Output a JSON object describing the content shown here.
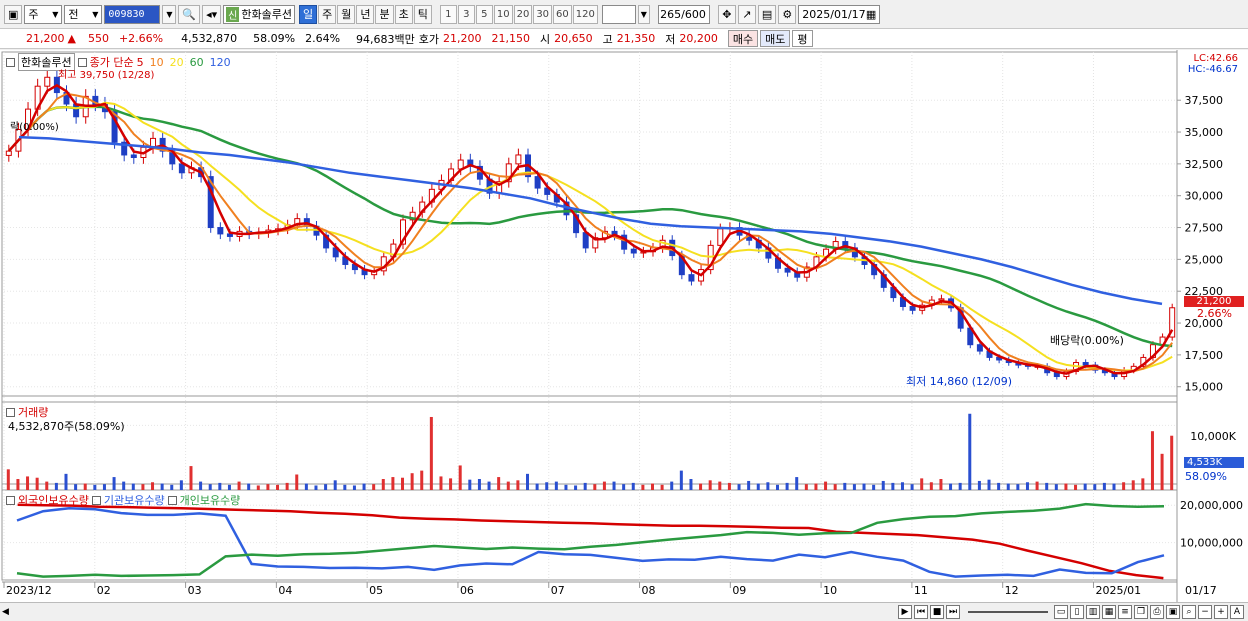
{
  "toolbar": {
    "period_type": "주",
    "prev_label": "전",
    "stock_code": "009830",
    "shin_badge": "신",
    "stock_name": "한화솔루션",
    "period_tabs": [
      "일",
      "주",
      "월",
      "년",
      "분",
      "초",
      "틱"
    ],
    "active_period": "일",
    "interval_buttons": [
      "1",
      "3",
      "5",
      "10",
      "20",
      "30",
      "60",
      "120"
    ],
    "count_current": "265",
    "count_max": "/600",
    "date": "2025/01/17"
  },
  "quote": {
    "price": "21,200",
    "change_arrow": "▲",
    "change": "550",
    "change_pct": "+2.66%",
    "volume": "4,532,870",
    "volume_ratio": "58.09%",
    "turnover": "2.64%",
    "amount": "94,683백만",
    "ask_label": "호가",
    "ask": "21,200",
    "bid": "21,150",
    "open_label": "시",
    "open": "20,650",
    "high_label": "고",
    "high": "21,350",
    "low_label": "저",
    "low": "20,200",
    "buy_label": "매수",
    "sell_label": "매도",
    "eval_label": "평"
  },
  "chart_data": {
    "type": "line",
    "price_panel": {
      "name": "한화솔루션",
      "indicator_label": "종가 단순",
      "ma_periods": [
        "5",
        "10",
        "20",
        "60",
        "120"
      ],
      "ma_colors": [
        "#d40000",
        "#f08020",
        "#f5e020",
        "#2a9a40",
        "#3060e0"
      ],
      "lc_label": "LC:42.66",
      "hc_label": "HC:-46.67",
      "y_ticks": [
        "37,500",
        "35,000",
        "32,500",
        "30,000",
        "27,500",
        "25,000",
        "22,500",
        "20,000",
        "17,500",
        "15,000"
      ],
      "ylim": [
        13800,
        40500
      ],
      "current_price_tag": "21,200",
      "current_pct_tag": "2.66%",
      "high_annotation": "최고 39,750 (12/28)",
      "low_annotation": "최저 14,860 (12/09)",
      "ex_right_annotation": "락(0.00%)",
      "dividend_annotation": "배당락(0.00%)"
    },
    "x_labels": [
      "2023/12",
      "02",
      "03",
      "04",
      "05",
      "06",
      "07",
      "08",
      "09",
      "10",
      "11",
      "12",
      "2025/01",
      "01/17"
    ],
    "close": [
      33500,
      35200,
      36800,
      38600,
      39300,
      38100,
      37200,
      36200,
      37800,
      37200,
      36600,
      34200,
      33200,
      33000,
      33800,
      34500,
      33500,
      32500,
      31800,
      32200,
      31500,
      27500,
      27000,
      26800,
      27200,
      27000,
      27100,
      27300,
      27400,
      27700,
      28200,
      27600,
      26900,
      25900,
      25200,
      24600,
      24200,
      23800,
      24100,
      25200,
      26200,
      28100,
      28700,
      29500,
      30500,
      31200,
      32100,
      32800,
      32300,
      31300,
      30200,
      31100,
      32500,
      33200,
      31500,
      30600,
      30100,
      29500,
      28500,
      27100,
      25900,
      26700,
      27200,
      26900,
      25800,
      25500,
      25600,
      25900,
      26500,
      25300,
      23800,
      23300,
      24200,
      26100,
      27400,
      27500,
      26900,
      26500,
      25900,
      25100,
      24300,
      24000,
      23600,
      24400,
      25200,
      25800,
      26400,
      25900,
      25200,
      24600,
      23800,
      22800,
      22000,
      21300,
      21000,
      21400,
      21800,
      21900,
      21200,
      19600,
      18300,
      17800,
      17300,
      17100,
      16900,
      16700,
      16600,
      16600,
      16100,
      15800,
      16200,
      16900,
      16700,
      16300,
      16100,
      15800,
      16300,
      16600,
      17300,
      18300,
      18900,
      21200
    ],
    "ma120": [
      34600,
      34500,
      34300,
      34100,
      33900,
      33700,
      33400,
      33200,
      32900,
      32600,
      32200,
      31800,
      31500,
      31200,
      30900,
      30600,
      30200,
      29800,
      29200,
      28700,
      28200,
      27800,
      27600,
      27500,
      27400,
      27300,
      27200,
      27000,
      26700,
      26400,
      26000,
      25500,
      25000,
      24400,
      23700,
      23000,
      22400,
      21900,
      21500
    ],
    "volume_panel": {
      "label": "거래량",
      "value_label": "4,532,870주(58.09%)",
      "axis_tick": "10,000K",
      "current_tag": "4,533K",
      "ratio_tag": "58.09%",
      "ylim": [
        0,
        13000
      ]
    },
    "volume": [
      3200,
      1700,
      2100,
      1900,
      1300,
      1100,
      2500,
      900,
      1000,
      800,
      900,
      2000,
      1300,
      1000,
      900,
      1200,
      1000,
      800,
      1500,
      3700,
      1300,
      900,
      1100,
      800,
      1300,
      1000,
      700,
      900,
      800,
      1100,
      2400,
      1000,
      700,
      900,
      1500,
      800,
      700,
      1000,
      900,
      1700,
      2000,
      1900,
      2600,
      3000,
      11300,
      2100,
      1800,
      3800,
      1600,
      1700,
      1300,
      2000,
      1300,
      1500,
      2500,
      1000,
      1200,
      1300,
      800,
      700,
      1100,
      900,
      1300,
      1300,
      900,
      1100,
      800,
      1000,
      800,
      1300,
      3000,
      1700,
      1000,
      1500,
      1300,
      1100,
      900,
      1400,
      1000,
      1200,
      800,
      1100,
      2000,
      900,
      1000,
      1300,
      900,
      1100,
      900,
      1000,
      800,
      1400,
      1100,
      1200,
      900,
      1800,
      1200,
      1700,
      1000,
      1100,
      11800,
      1400,
      1600,
      1100,
      1000,
      900,
      1200,
      1300,
      1100,
      900,
      1000,
      800,
      1000,
      900,
      1100,
      1000,
      1200,
      1500,
      1800,
      9100,
      5600,
      8400
    ],
    "holding_panel": {
      "legend": [
        "외국인보유수량",
        "기관보유수량",
        "개인보유수량"
      ],
      "colors": [
        "#d40000",
        "#3060e0",
        "#2a9a40"
      ],
      "y_ticks": [
        "20,000,000",
        "10,000,000"
      ],
      "ylim": [
        0,
        23000000
      ],
      "foreign": [
        20100000,
        20000000,
        19900000,
        19600000,
        19500000,
        19300000,
        19200000,
        19000000,
        18800000,
        18600000,
        18400000,
        18000000,
        17700000,
        17300000,
        16700000,
        16400000,
        16200000,
        15900000,
        15700000,
        15500000,
        15300000,
        15200000,
        14900000,
        14700000,
        14500000,
        14500000,
        14400000,
        14200000,
        14000000,
        13900000,
        12900000,
        12600000,
        12300000,
        12000000,
        11400000,
        10800000,
        9700000,
        7900000,
        6200000,
        4500000,
        2500000,
        1300000,
        500000
      ],
      "institution": [
        15900000,
        18400000,
        19200000,
        18900000,
        17900000,
        17400000,
        17400000,
        17800000,
        17200000,
        4300000,
        3600000,
        3500000,
        3200000,
        3300000,
        3100000,
        3500000,
        2700000,
        3900000,
        4400000,
        4200000,
        7500000,
        6900000,
        6700000,
        5900000,
        5100000,
        5500000,
        5400000,
        6200000,
        5600000,
        5200000,
        6800000,
        6100000,
        7500000,
        6200000,
        5200000,
        2200000,
        900000,
        1200000,
        1400000,
        1100000,
        2800000,
        1900000,
        1800000,
        4800000,
        6600000
      ],
      "individual": [
        1800000,
        900000,
        1100000,
        1400000,
        1100000,
        1200000,
        1300000,
        1500000,
        6300000,
        6800000,
        6500000,
        6900000,
        7000000,
        7300000,
        7900000,
        8500000,
        9100000,
        8700000,
        8300000,
        8700000,
        8400000,
        8200000,
        8900000,
        9400000,
        10100000,
        10800000,
        11400000,
        12000000,
        12800000,
        12600000,
        12100000,
        12500000,
        12600000,
        15300000,
        16300000,
        16900000,
        17100000,
        17800000,
        18200000,
        18500000,
        19100000,
        20300000,
        19800000,
        19600000,
        19700000
      ]
    }
  }
}
